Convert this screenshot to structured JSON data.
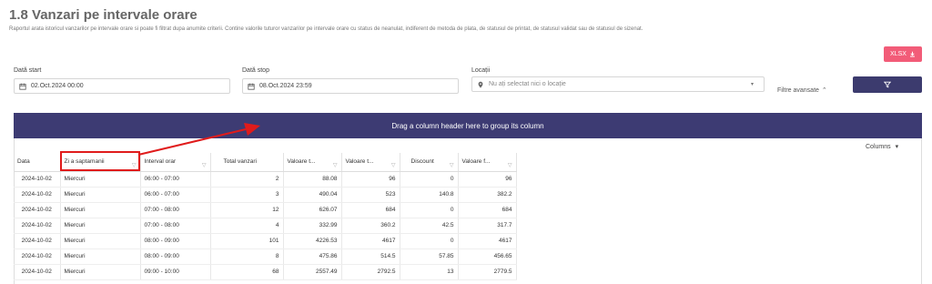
{
  "header": {
    "title": "1.8 Vanzari pe intervale orare",
    "description": "Raportul arata istoricul vanzarilor pe intervale orare si poate fi filtrat dupa anumite criterii. Contine valorile tuturor vanzarilor pe intervale orare cu status de neanulat, indiferent de metoda de plata, de statusul de printat, de statusul validat sau de statusul de sizenat."
  },
  "toolbar": {
    "xlsx_label": "XLSX"
  },
  "filters": {
    "start_label": "Dată start",
    "start_value": "02.Oct.2024 00:00",
    "stop_label": "Dată stop",
    "stop_value": "08.Oct.2024 23:59",
    "location_label": "Locații",
    "location_placeholder": "Nu ați selectat nici o locație",
    "advanced_label": "Filtre avansate"
  },
  "grid": {
    "group_panel_text": "Drag a column header here to group its column",
    "columns_label": "Columns",
    "headers": [
      "Data",
      "Zi a saptamanii",
      "Interval orar",
      "Total vanzari",
      "Valoare t...",
      "Valoare t...",
      "Discount",
      "Valoare f..."
    ],
    "rows": [
      [
        "2024-10-02",
        "Miercuri",
        "06:00 - 07:00",
        "2",
        "88.08",
        "96",
        "0",
        "96"
      ],
      [
        "2024-10-02",
        "Miercuri",
        "06:00 - 07:00",
        "3",
        "490.04",
        "523",
        "140.8",
        "382.2"
      ],
      [
        "2024-10-02",
        "Miercuri",
        "07:00 - 08:00",
        "12",
        "626.07",
        "684",
        "0",
        "684"
      ],
      [
        "2024-10-02",
        "Miercuri",
        "07:00 - 08:00",
        "4",
        "332.99",
        "360.2",
        "42.5",
        "317.7"
      ],
      [
        "2024-10-02",
        "Miercuri",
        "08:00 - 09:00",
        "101",
        "4226.53",
        "4617",
        "0",
        "4617"
      ],
      [
        "2024-10-02",
        "Miercuri",
        "08:00 - 09:00",
        "8",
        "475.86",
        "514.5",
        "57.85",
        "456.65"
      ],
      [
        "2024-10-02",
        "Miercuri",
        "09:00 - 10:00",
        "68",
        "2557.49",
        "2792.5",
        "13",
        "2779.5"
      ]
    ]
  },
  "colors": {
    "accent": "#3d3b73",
    "export": "#f25c78",
    "highlight": "#e01b1b"
  }
}
